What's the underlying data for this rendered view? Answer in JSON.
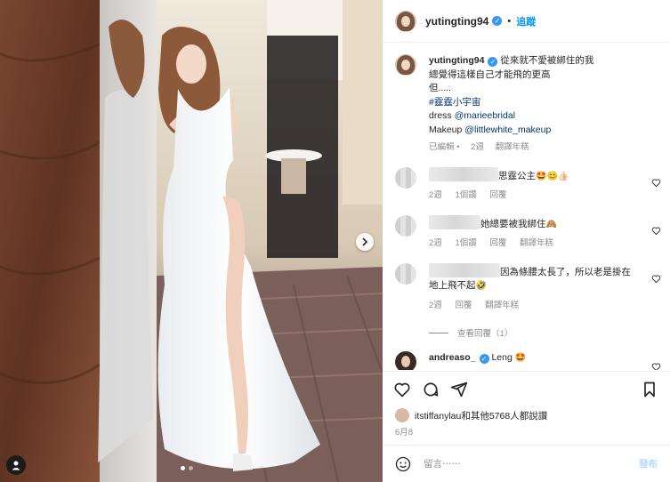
{
  "post": {
    "username": "yutingting94",
    "follow_label": "追蹤",
    "separator": "•"
  },
  "caption": {
    "username": "yutingting94",
    "line1": "從來就不愛被綁住的我",
    "line2": "總覺得這樣自己才能飛的更高",
    "line3": "但.....",
    "hashtag": "#霆霆小宇宙",
    "dress_prefix": "dress ",
    "dress_handle": "@marieebridal",
    "makeup_prefix": "Makeup ",
    "makeup_handle": "@littlewhite_makeup",
    "edited": "已編輯",
    "time": "2週",
    "translate": "翻譯年糕"
  },
  "comments": [
    {
      "text": "思霆公主",
      "emoji": "🤩😊👍🏻",
      "time": "2週",
      "likes": "1個讚",
      "reply": "回覆"
    },
    {
      "text": "她總要被我綁住",
      "emoji": "🙈",
      "time": "2週",
      "likes": "1個讚",
      "reply": "回覆",
      "translate": "翻譯年糕"
    },
    {
      "text1": "因為條腰太長了，所以老是掛在",
      "text2": "地上飛不起",
      "emoji": "🤣",
      "time": "2週",
      "reply": "回覆",
      "translate": "翻譯年糕",
      "view_replies": "查看回覆（1）"
    },
    {
      "username": "andreaso_",
      "text": "Leng",
      "emoji": "🤩"
    }
  ],
  "likes": {
    "text": "itstiffanylau和其他5768人都說讚"
  },
  "date": "6月8",
  "composer": {
    "placeholder": "留言⋯⋯",
    "post_label": "發布"
  },
  "icons": {
    "heart": "heart-icon",
    "comment": "comment-icon",
    "share": "share-icon",
    "save": "bookmark-icon",
    "emoji": "emoji-icon",
    "next": "chevron-right-icon",
    "tag": "user-tag-icon"
  },
  "colors": {
    "link": "#00376b",
    "follow": "#0095f6",
    "muted": "#8e8e8e",
    "verified": "#3897f0"
  }
}
